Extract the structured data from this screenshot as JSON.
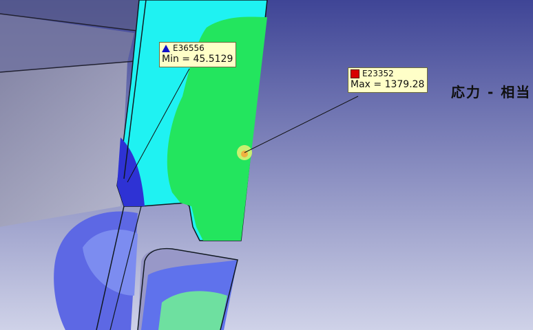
{
  "viewport": {
    "background_top": "#4a4f9a",
    "background_bottom": "#c8cbe4"
  },
  "result": {
    "title": "応力 - 相当"
  },
  "probes": {
    "min": {
      "element_id": "E36556",
      "label": "Min = 45.5129",
      "marker": "triangle-icon",
      "color": "#1010c8"
    },
    "max": {
      "element_id": "E23352",
      "label": "Max = 1379.28",
      "marker": "square-icon",
      "color": "#d80000"
    }
  },
  "contour_colors": [
    "#2b2bd6",
    "#5a6cf0",
    "#1ff0f0",
    "#22e860",
    "#c0f060",
    "#f0a020"
  ]
}
